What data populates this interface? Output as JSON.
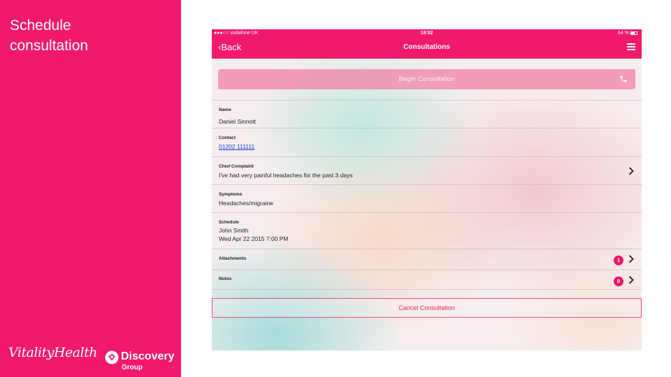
{
  "slide": {
    "title": "Schedule consultation",
    "brand": {
      "vitality": "VitalityHealth",
      "discovery_name": "Discovery",
      "discovery_sub": "Group"
    }
  },
  "status_bar": {
    "carrier": "●●●○○ vodafone UK",
    "time": "18:02",
    "battery": "64 %"
  },
  "nav": {
    "back_label": "‹Back",
    "title": "Consultations",
    "menu_icon": "hamburger-menu-icon"
  },
  "begin_button": {
    "label": "Begin Consultation",
    "icon": "phone-icon"
  },
  "fields": {
    "name": {
      "label": "Name",
      "value": "Daniel Sinnott"
    },
    "contact": {
      "label": "Contact",
      "value": "01202 111111"
    },
    "chief_complaint": {
      "label": "Chief Complaint",
      "value": "I've had very painful headaches for the past 3 days"
    },
    "symptoms": {
      "label": "Symptoms",
      "value": "Headaches/migraine"
    },
    "schedule": {
      "label": "Schedule",
      "doctor": "John Smith",
      "datetime": "Wed Apr 22 2015 7:00 PM"
    },
    "attachments": {
      "label": "Attachments",
      "count": "1"
    },
    "notes": {
      "label": "Notes",
      "count": "0"
    }
  },
  "cancel_button": {
    "label": "Cancel Consultation"
  },
  "colors": {
    "brand_pink": "#f2196b",
    "badge_pink": "#e8166b",
    "link_blue": "#1a37d6"
  }
}
